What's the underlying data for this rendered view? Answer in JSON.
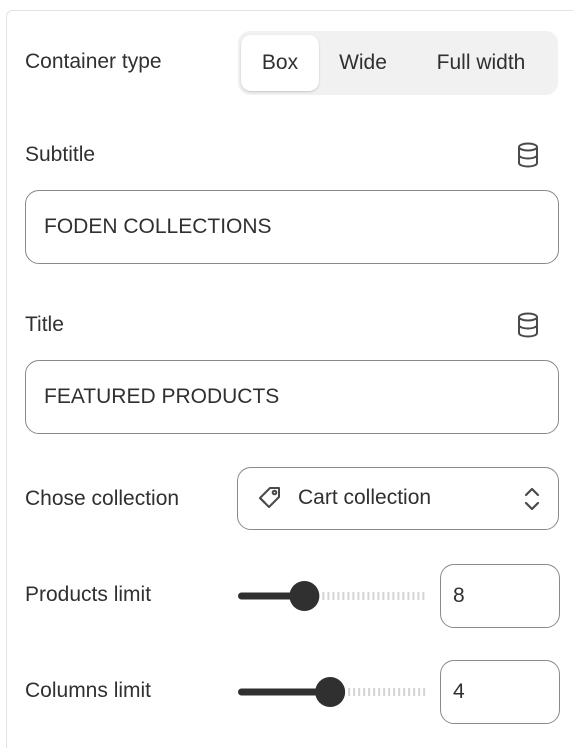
{
  "container_type": {
    "label": "Container type",
    "options": [
      "Box",
      "Wide",
      "Full width"
    ],
    "selected": "Box"
  },
  "subtitle": {
    "label": "Subtitle",
    "value": "FODEN COLLECTIONS",
    "icon": "database-icon"
  },
  "title": {
    "label": "Title",
    "value": "FEATURED PRODUCTS",
    "icon": "database-icon"
  },
  "collection": {
    "label": "Chose collection",
    "value": "Cart collection",
    "icon": "tag-icon"
  },
  "products_limit": {
    "label": "Products limit",
    "value": "8",
    "fraction": 0.35
  },
  "columns_limit": {
    "label": "Columns limit",
    "value": "4",
    "fraction": 0.49
  },
  "colors": {
    "border": "#8a8a8a",
    "text": "#303030",
    "slider_fill": "#303030",
    "slider_track": "#d4d4d4"
  }
}
